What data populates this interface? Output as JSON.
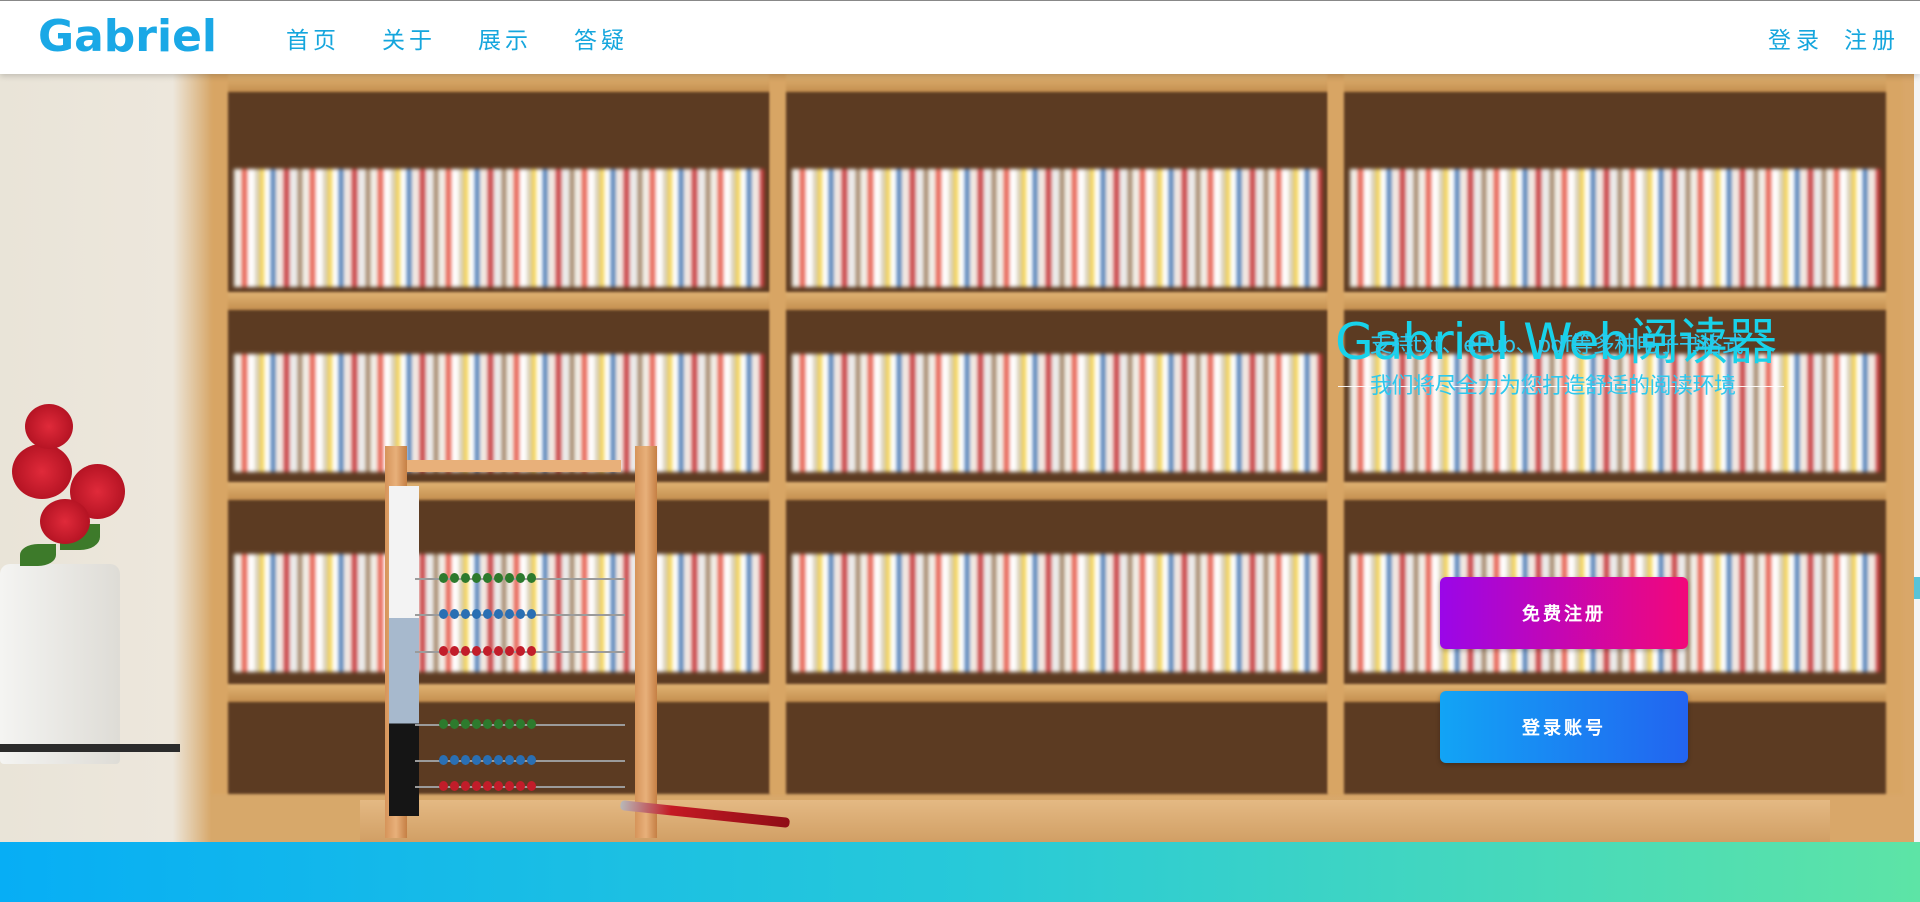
{
  "header": {
    "brand": "Gabriel",
    "nav": [
      {
        "label": "首页"
      },
      {
        "label": "关于"
      },
      {
        "label": "展示"
      },
      {
        "label": "答疑"
      }
    ],
    "auth": {
      "login_label": "登录",
      "register_label": "注册"
    }
  },
  "hero": {
    "title": "Gabriel Web阅读器",
    "subtitle_line1": "支持txt、ePub、pdf等多种电子书格式",
    "subtitle_line2": "我们将尽全力为您打造舒适的阅读环境",
    "register_button": "免费注册",
    "login_button": "登录账号"
  },
  "colors": {
    "accent": "#15a6dd",
    "title": "#18d2ea",
    "register_gradient": [
      "#9a06e8",
      "#f2077a"
    ],
    "login_gradient": [
      "#12a4f5",
      "#2264f0"
    ],
    "footer_gradient": [
      "#07aef5",
      "#5de4a6"
    ]
  }
}
